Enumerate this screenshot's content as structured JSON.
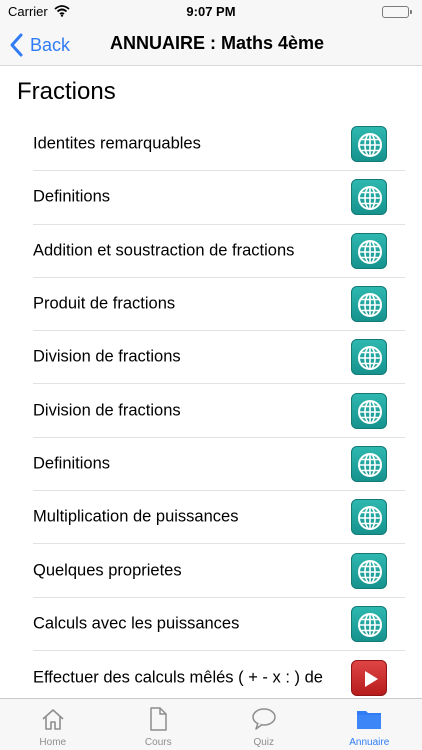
{
  "status_bar": {
    "carrier": "Carrier",
    "time": "9:07 PM"
  },
  "nav": {
    "back_label": "Back",
    "title": "ANNUAIRE : Maths 4ème"
  },
  "section": {
    "title": "Fractions"
  },
  "items": [
    {
      "label": "Identites remarquables",
      "icon": "globe-icon"
    },
    {
      "label": "Definitions",
      "icon": "globe-icon"
    },
    {
      "label": "Addition et soustraction de fractions",
      "icon": "globe-icon"
    },
    {
      "label": "Produit de fractions",
      "icon": "globe-icon"
    },
    {
      "label": "Division de fractions",
      "icon": "globe-icon"
    },
    {
      "label": "Division de fractions",
      "icon": "globe-icon"
    },
    {
      "label": "Definitions",
      "icon": "globe-icon"
    },
    {
      "label": "Multiplication de puissances",
      "icon": "globe-icon"
    },
    {
      "label": "Quelques proprietes",
      "icon": "globe-icon"
    },
    {
      "label": "Calculs avec les puissances",
      "icon": "globe-icon"
    },
    {
      "label": "Effectuer des calculs mêlés ( + - x : ) de",
      "icon": "play-icon"
    }
  ],
  "tabs": [
    {
      "label": "Home",
      "icon": "home-icon"
    },
    {
      "label": "Cours",
      "icon": "document-icon"
    },
    {
      "label": "Quiz",
      "icon": "speech-bubble-icon"
    },
    {
      "label": "Annuaire",
      "icon": "folder-icon"
    }
  ],
  "colors": {
    "accent": "#2f7cf6",
    "globe_tile": "#1fa39d",
    "play_tile": "#c62828",
    "battery": "#4cd964"
  }
}
